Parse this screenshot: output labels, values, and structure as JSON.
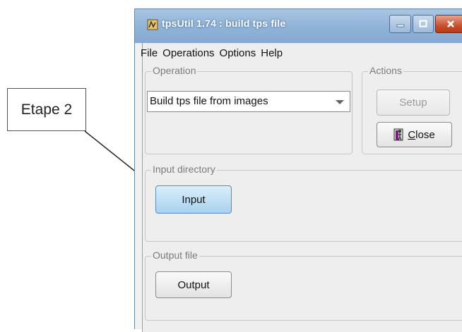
{
  "callout": {
    "text": "Etape 2"
  },
  "window": {
    "title": "tpsUtil 1.74 : build tps file"
  },
  "menu": [
    "File",
    "Operations",
    "Options",
    "Help"
  ],
  "operation": {
    "legend": "Operation",
    "selected": "Build tps file from images"
  },
  "actions": {
    "legend": "Actions",
    "setup_label": "Setup",
    "close_label_first": "C",
    "close_label_rest": "lose"
  },
  "input": {
    "legend": "Input directory",
    "button_label": "Input"
  },
  "output": {
    "legend": "Output file",
    "button_label": "Output"
  }
}
